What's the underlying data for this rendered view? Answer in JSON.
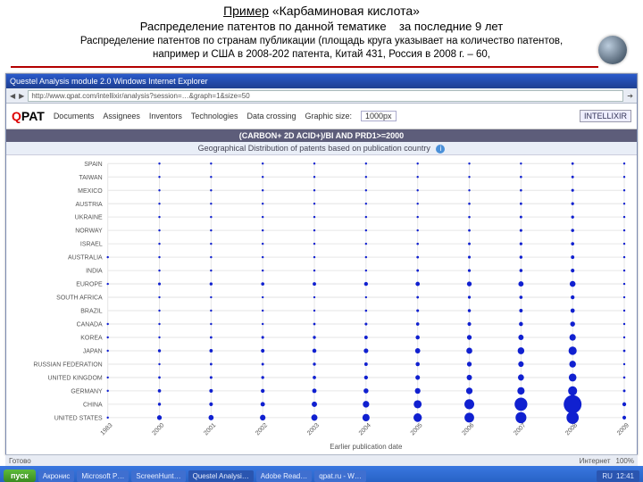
{
  "header": {
    "example_label": "Пример",
    "quoted": "«Карбаминовая кислота»",
    "subtitle_a": "Распределение патентов по  данной тематике",
    "subtitle_b": "за последние 9 лет",
    "desc1": "Распределение патентов по странам публикации (площадь  круга указывает на  количество патентов,",
    "desc2": "например и  США  в 2008-202 патента, Китай 431,  Россия в 2008 г. – 60,"
  },
  "browser": {
    "window_title": "Questel Analysis module   2.0   Windows Internet Explorer",
    "url": "http://www.qpat.com/intellixir/analysis?session=…&graph=1&size=50",
    "status_done": "Готово",
    "status_net": "Интернет",
    "zoom": "100%"
  },
  "app": {
    "logo_text": "QPAT",
    "tabs": [
      "Documents",
      "Assignees",
      "Inventors",
      "Technologies",
      "Data crossing"
    ],
    "graphic_size_label": "Graphic size:",
    "graphic_size_value": "1000px",
    "intellixir": "INTELLIXIR"
  },
  "query_bar": "(CARBON+ 2D ACID+)/BI AND PRD1>=2000",
  "geo_bar": "Geographical Distribution of patents based on publication country",
  "axis_x_title": "Earlier publication date",
  "taskbar": {
    "start": "пуск",
    "tasks": [
      "Акронис",
      "Microsoft P…",
      "ScreenHunt…",
      "Questel Analysi…",
      "Adobe Read…",
      "qpat.ru - W…"
    ],
    "active_index": 3,
    "tray_icons": [
      "RU"
    ],
    "clock": "12:41"
  },
  "chart_data": {
    "type": "bubble",
    "xlabel": "Earlier publication date",
    "ylabel": "",
    "note": "area of circle = patent count; values estimated from figure; reference: USA 2008≈202, China 2008≈431, Russia 2008≈60",
    "x": [
      1983,
      2000,
      2001,
      2002,
      2003,
      2004,
      2005,
      2006,
      2007,
      2008,
      2009
    ],
    "countries": [
      "SPAIN",
      "TAIWAN",
      "MEXICO",
      "AUSTRIA",
      "UKRAINE",
      "NORWAY",
      "ISRAEL",
      "AUSTRALIA",
      "INDIA",
      "EUROPE",
      "SOUTH AFRICA",
      "BRAZIL",
      "CANADA",
      "KOREA",
      "JAPAN",
      "RUSSIAN FEDERATION",
      "UNITED KINGDOM",
      "GERMANY",
      "CHINA",
      "UNITED STATES"
    ],
    "matrix": [
      [
        0,
        1,
        2,
        1,
        2,
        3,
        4,
        5,
        6,
        8,
        2
      ],
      [
        0,
        2,
        2,
        3,
        3,
        4,
        5,
        6,
        7,
        9,
        2
      ],
      [
        0,
        1,
        2,
        2,
        3,
        4,
        5,
        6,
        7,
        10,
        2
      ],
      [
        0,
        1,
        2,
        2,
        3,
        4,
        5,
        7,
        8,
        11,
        2
      ],
      [
        0,
        2,
        2,
        3,
        3,
        5,
        6,
        7,
        9,
        12,
        2
      ],
      [
        0,
        1,
        2,
        2,
        3,
        4,
        6,
        8,
        10,
        13,
        3
      ],
      [
        0,
        2,
        2,
        3,
        4,
        5,
        7,
        9,
        11,
        14,
        3
      ],
      [
        1,
        3,
        3,
        4,
        5,
        6,
        8,
        10,
        12,
        16,
        3
      ],
      [
        0,
        2,
        3,
        3,
        4,
        6,
        8,
        11,
        13,
        18,
        3
      ],
      [
        4,
        10,
        12,
        14,
        16,
        20,
        24,
        30,
        36,
        45,
        6
      ],
      [
        0,
        2,
        3,
        3,
        4,
        6,
        8,
        11,
        14,
        20,
        3
      ],
      [
        0,
        3,
        3,
        4,
        5,
        7,
        10,
        13,
        16,
        24,
        3
      ],
      [
        1,
        4,
        5,
        6,
        8,
        10,
        14,
        18,
        22,
        32,
        4
      ],
      [
        1,
        6,
        8,
        10,
        12,
        16,
        22,
        30,
        38,
        55,
        6
      ],
      [
        2,
        12,
        15,
        18,
        22,
        28,
        36,
        48,
        60,
        90,
        8
      ],
      [
        0,
        6,
        8,
        9,
        12,
        16,
        22,
        30,
        40,
        60,
        5
      ],
      [
        1,
        8,
        10,
        12,
        15,
        20,
        28,
        38,
        50,
        80,
        7
      ],
      [
        2,
        14,
        17,
        20,
        25,
        32,
        42,
        56,
        72,
        110,
        9
      ],
      [
        0,
        12,
        18,
        26,
        38,
        56,
        85,
        130,
        220,
        431,
        20
      ],
      [
        3,
        30,
        35,
        42,
        52,
        70,
        95,
        125,
        160,
        202,
        18
      ]
    ]
  }
}
